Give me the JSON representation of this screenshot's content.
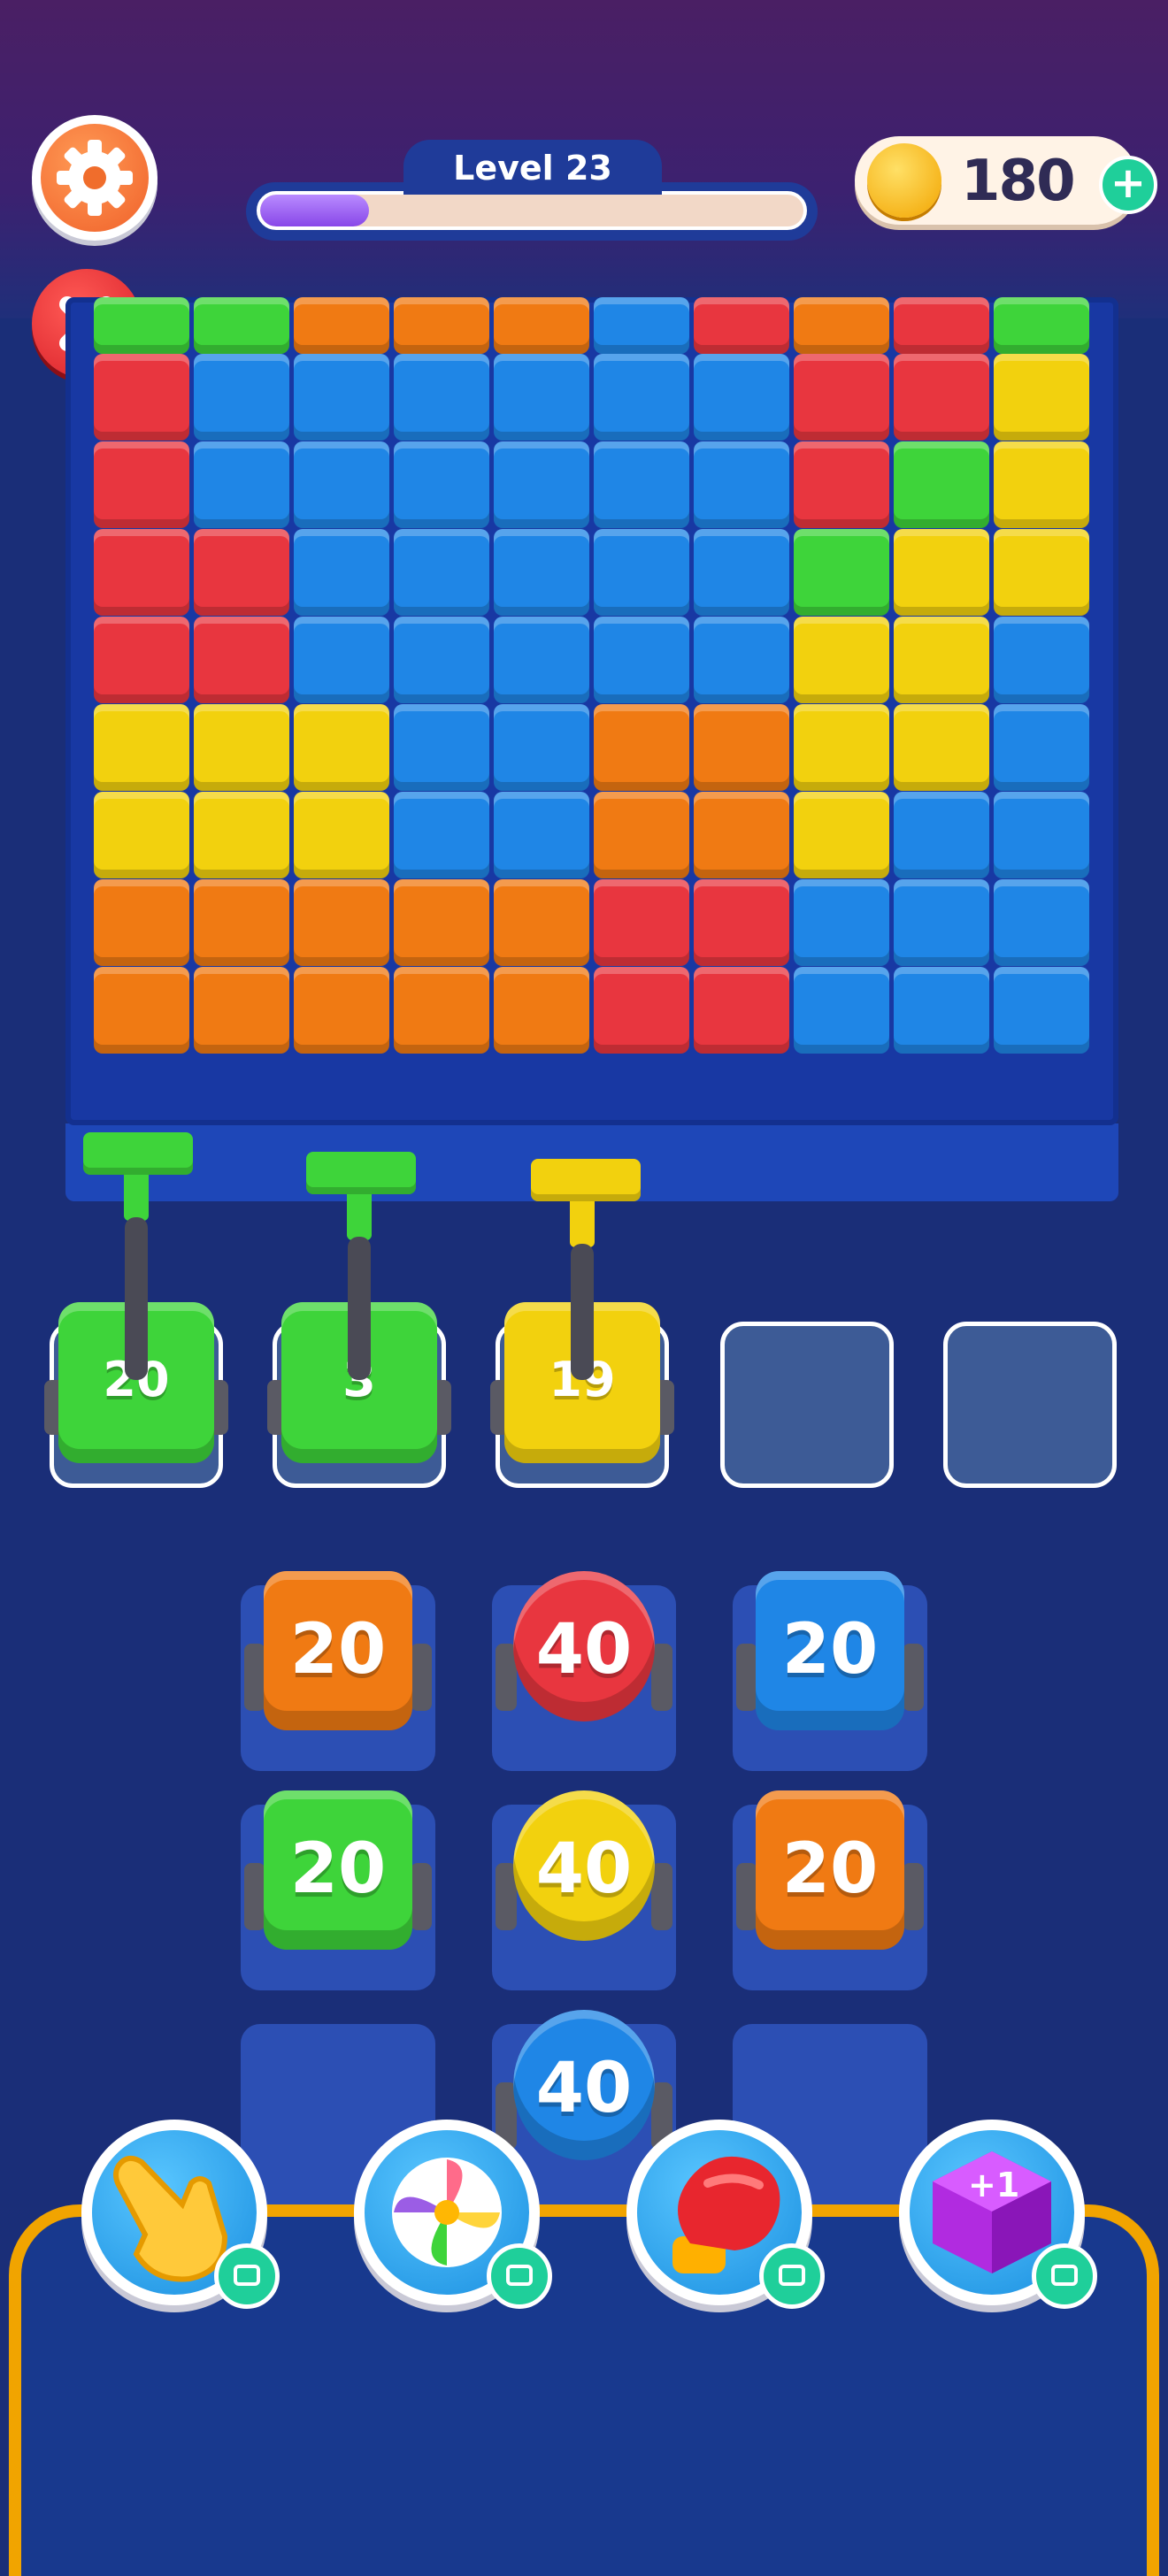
{
  "header": {
    "level_label": "Level 23",
    "level_progress": 0.2,
    "coins": "180",
    "coin_plus": "+"
  },
  "colors": {
    "red": "#e8363f",
    "blue": "#1f86e6",
    "green": "#3ed43a",
    "orange": "#f07a13",
    "yellow": "#f2d10e",
    "empty_slot": "#3d5b96"
  },
  "board": {
    "top_row": [
      "green",
      "green",
      "orange",
      "orange",
      "orange",
      "blue",
      "red",
      "orange",
      "red",
      "green"
    ],
    "rows": [
      [
        "red",
        "blue",
        "blue",
        "blue",
        "blue",
        "blue",
        "blue",
        "red",
        "red",
        "yellow"
      ],
      [
        "red",
        "blue",
        "blue",
        "blue",
        "blue",
        "blue",
        "blue",
        "red",
        "green",
        "yellow"
      ],
      [
        "red",
        "red",
        "blue",
        "blue",
        "blue",
        "blue",
        "blue",
        "green",
        "yellow",
        "yellow"
      ],
      [
        "red",
        "red",
        "blue",
        "blue",
        "blue",
        "blue",
        "blue",
        "yellow",
        "yellow",
        "blue"
      ],
      [
        "yellow",
        "yellow",
        "yellow",
        "blue",
        "blue",
        "orange",
        "orange",
        "yellow",
        "yellow",
        "blue"
      ],
      [
        "yellow",
        "yellow",
        "yellow",
        "blue",
        "blue",
        "orange",
        "orange",
        "yellow",
        "blue",
        "blue"
      ],
      [
        "orange",
        "orange",
        "orange",
        "orange",
        "orange",
        "red",
        "red",
        "blue",
        "blue",
        "blue"
      ],
      [
        "orange",
        "orange",
        "orange",
        "orange",
        "orange",
        "red",
        "red",
        "blue",
        "blue",
        "blue"
      ]
    ]
  },
  "active_slots": [
    {
      "color": "green",
      "count": "20"
    },
    {
      "color": "green",
      "count": "3"
    },
    {
      "color": "yellow",
      "count": "19"
    },
    {
      "color": "empty",
      "count": ""
    },
    {
      "color": "empty",
      "count": ""
    }
  ],
  "queue": [
    [
      {
        "color": "orange",
        "count": "20",
        "shape": "cart"
      },
      {
        "color": "red",
        "count": "40",
        "shape": "round"
      },
      {
        "color": "blue",
        "count": "20",
        "shape": "cart"
      }
    ],
    [
      {
        "color": "green",
        "count": "20",
        "shape": "cart"
      },
      {
        "color": "yellow",
        "count": "40",
        "shape": "round"
      },
      {
        "color": "orange",
        "count": "20",
        "shape": "cart"
      }
    ],
    [
      {
        "color": "empty",
        "count": "",
        "shape": "pad"
      },
      {
        "color": "blue",
        "count": "40",
        "shape": "round"
      },
      {
        "color": "empty",
        "count": "",
        "shape": "pad"
      }
    ]
  ],
  "boosters": [
    {
      "icon": "hand-pointer-icon",
      "label": ""
    },
    {
      "icon": "pinwheel-icon",
      "label": ""
    },
    {
      "icon": "boxing-glove-icon",
      "label": ""
    },
    {
      "icon": "plus-one-cube-icon",
      "label": "+1"
    }
  ]
}
